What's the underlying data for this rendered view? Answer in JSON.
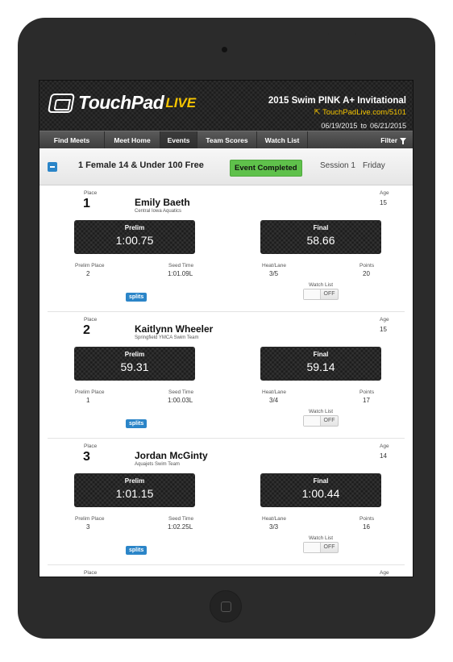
{
  "app": {
    "logo_main": "TouchPad",
    "logo_accent": "LIVE"
  },
  "meet": {
    "title": "2015 Swim PINK A+ Invitational",
    "url": "TouchPadLive.com/5101",
    "start_date": "06/19/2015",
    "to": "to",
    "end_date": "06/21/2015"
  },
  "nav": {
    "items": [
      {
        "label": "Find Meets",
        "active": false
      },
      {
        "label": "Meet Home",
        "active": false
      },
      {
        "label": "Events",
        "active": true
      },
      {
        "label": "Team Scores",
        "active": false
      },
      {
        "label": "Watch List",
        "active": false
      }
    ],
    "filter_label": "Filter"
  },
  "event": {
    "name": "1 Female 14 & Under 100 Free",
    "status": "Event Completed",
    "session": "Session 1",
    "day": "Friday"
  },
  "labels": {
    "place": "Place",
    "age": "Age",
    "prelim": "Prelim",
    "final": "Final",
    "prelim_place": "Prelim Place",
    "seed_time": "Seed Time",
    "heat_lane": "Heat/Lane",
    "points": "Points",
    "watch_list": "Watch List",
    "splits": "splits",
    "off": "OFF"
  },
  "results": [
    {
      "place": "1",
      "name": "Emily Baeth",
      "team": "Central Iowa Aquatics",
      "age": "15",
      "prelim": "1:00.75",
      "final": "58.66",
      "prelim_place": "2",
      "seed_time": "1:01.09L",
      "heat_lane": "3/5",
      "points": "20"
    },
    {
      "place": "2",
      "name": "Kaitlynn Wheeler",
      "team": "Springfield YMCA Swim Team",
      "age": "15",
      "prelim": "59.31",
      "final": "59.14",
      "prelim_place": "1",
      "seed_time": "1:00.03L",
      "heat_lane": "3/4",
      "points": "17"
    },
    {
      "place": "3",
      "name": "Jordan McGinty",
      "team": "Aquajets Swim Team",
      "age": "14",
      "prelim": "1:01.15",
      "final": "1:00.44",
      "prelim_place": "3",
      "seed_time": "1:02.25L",
      "heat_lane": "3/3",
      "points": "16"
    }
  ]
}
